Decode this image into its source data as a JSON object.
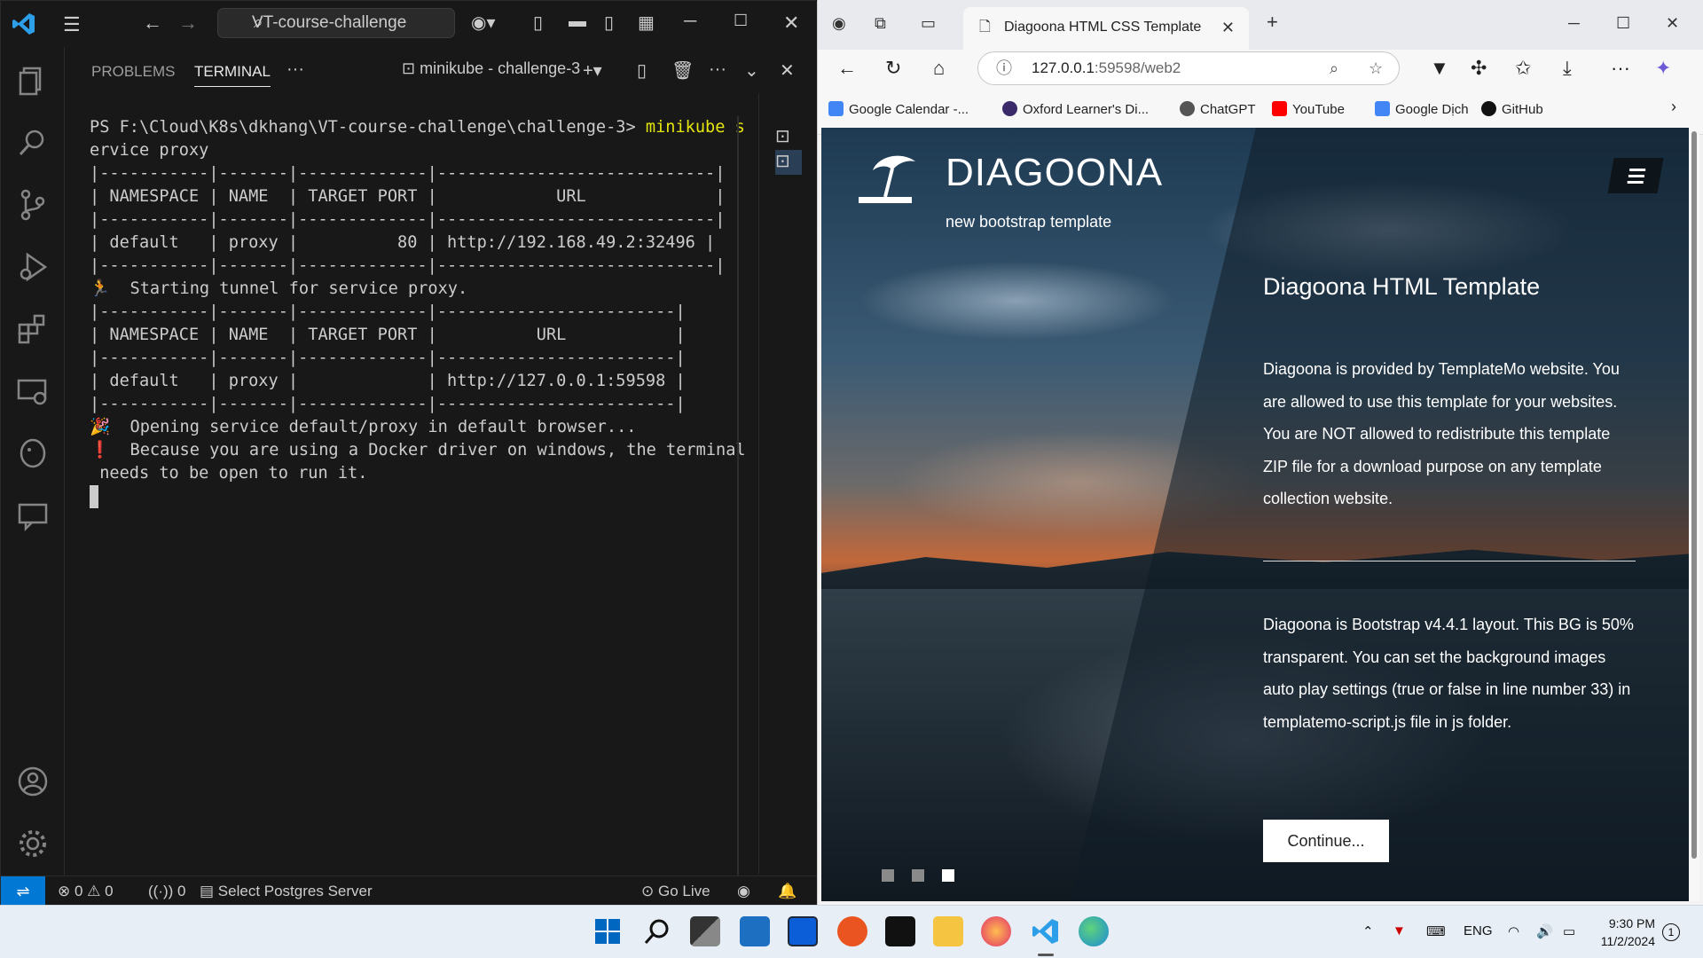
{
  "vscode": {
    "search": "VT-course-challenge",
    "panel_tabs": {
      "problems": "PROBLEMS",
      "terminal": "TERMINAL",
      "more": "···"
    },
    "terminal_name": "minikube - challenge-3",
    "terminal_lines": {
      "prompt": "PS F:\\Cloud\\K8s\\dkhang\\VT-course-challenge\\challenge-3> ",
      "cmd": "minikube s",
      "l2": "ervice proxy",
      "l3": "|-----------|-------|-------------|----------------------------|",
      "l4": "| NAMESPACE | NAME  | TARGET PORT |            URL             |",
      "l5": "|-----------|-------|-------------|----------------------------|",
      "l6": "| default   | proxy |          80 | http://192.168.49.2:32496 |",
      "l7": "|-----------|-------|-------------|----------------------------|",
      "l8": "🏃  Starting tunnel for service proxy.",
      "l9": "|-----------|-------|-------------|------------------------|",
      "l10": "| NAMESPACE | NAME  | TARGET PORT |          URL           |",
      "l11": "|-----------|-------|-------------|------------------------|",
      "l12": "| default   | proxy |             | http://127.0.0.1:59598 |",
      "l13": "|-----------|-------|-------------|------------------------|",
      "l14": "🎉  Opening service default/proxy in default browser...",
      "l15": "❗  Because you are using a Docker driver on windows, the terminal",
      "l16": " needs to be open to run it."
    },
    "status": {
      "problems": "⊗ 0 ⚠ 0",
      "ports": "0",
      "postgres": "Select Postgres Server",
      "golive": "Go Live"
    }
  },
  "edge": {
    "tab_title": "Diagoona HTML CSS Template",
    "address_host": "127.0.0.1",
    "address_rest": ":59598/web2",
    "bookmarks": [
      "Google Calendar -...",
      "Oxford Learner's Di...",
      "ChatGPT",
      "YouTube",
      "Google Dịch",
      "GitHub"
    ]
  },
  "web": {
    "brand": "DIAGOONA",
    "subtitle": "new bootstrap template",
    "title": "Diagoona HTML Template",
    "p1": "Diagoona is provided by TemplateMo website. You are allowed to use this template for your websites. You are NOT allowed to redistribute this template ZIP file for a download purpose on any template collection website.",
    "p2": "Diagoona is Bootstrap v4.4.1 layout. This BG is 50% transparent. You can set the background images auto play settings (true or false in line number 33) in templatemo-script.js file in js folder.",
    "continue": "Continue..."
  },
  "taskbar": {
    "lang": "ENG",
    "time": "9:30 PM",
    "date": "11/2/2024",
    "badge": "1"
  },
  "colors": {
    "vscode_bg": "#181818",
    "accent": "#0078d4",
    "terminal_cmd": "#e5e510"
  }
}
